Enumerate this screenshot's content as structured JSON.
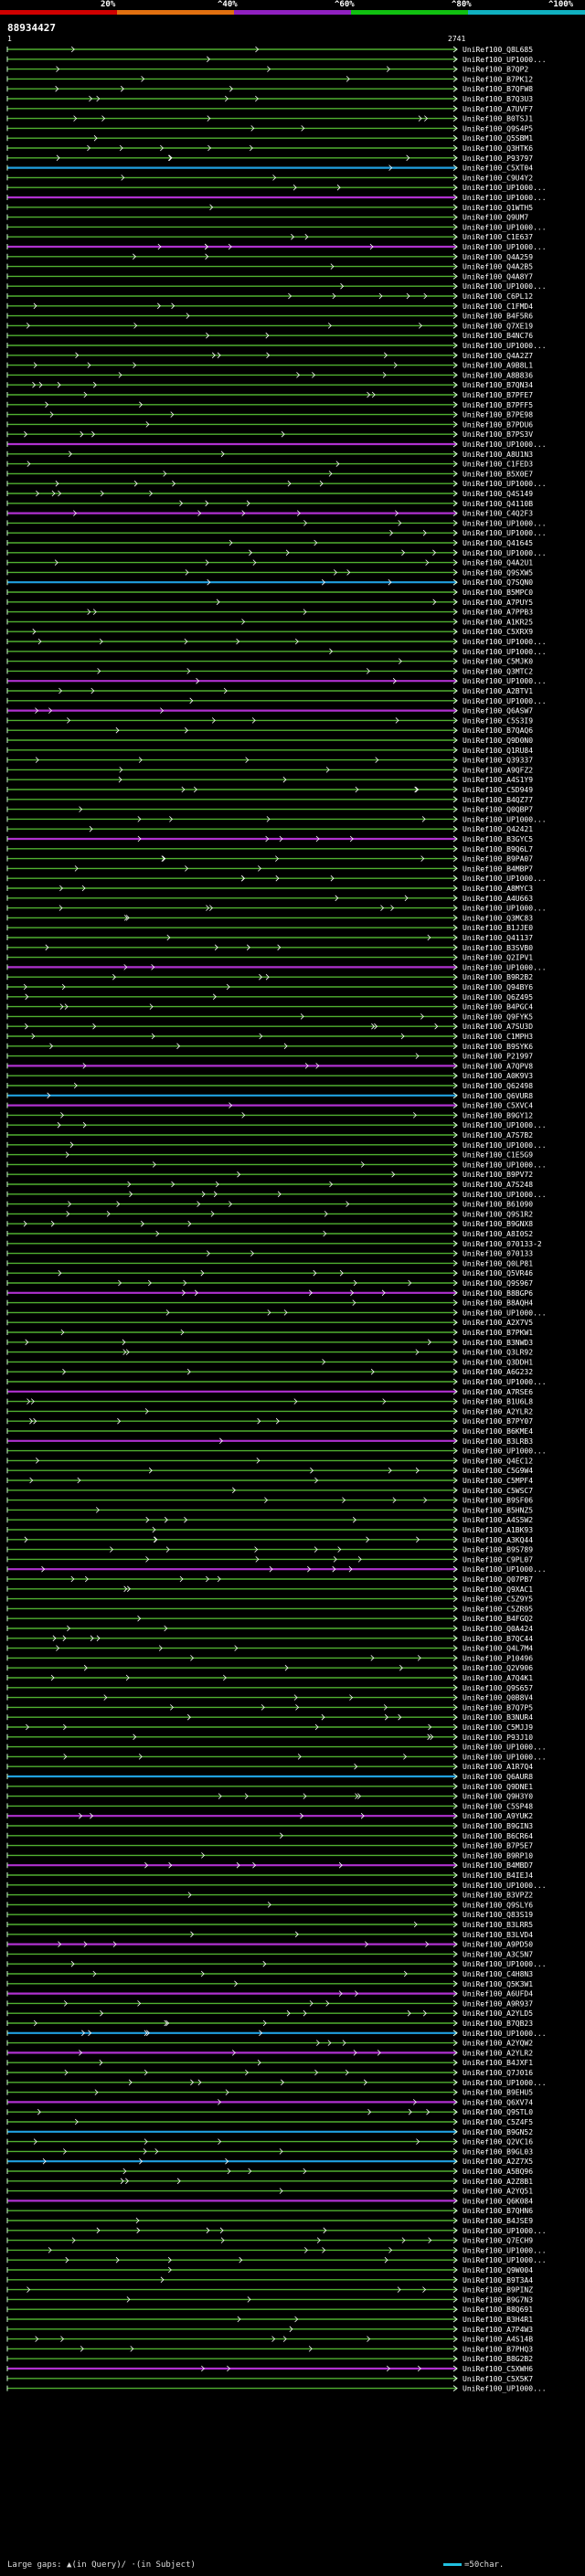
{
  "query": {
    "id": "88934427",
    "length_start": "1",
    "length_end": "2741"
  },
  "legend": {
    "ticks": [
      "20%",
      "^40%",
      "^60%",
      "^80%",
      "^100%"
    ],
    "colors": [
      "#d00000",
      "#e07010",
      "#9020c0",
      "#10c010",
      "#10b0c0"
    ]
  },
  "footer": {
    "note": "Large gaps: ▲(in Query)/ ·(in Subject)",
    "scale_label": "=50char."
  },
  "hits": [
    {
      "label": "UniRef100_Q8L685",
      "color": "#50b030"
    },
    {
      "label": "UniRef100_UP1000...",
      "color": "#50b030"
    },
    {
      "label": "UniRef100_B7QP2",
      "color": "#50b030"
    },
    {
      "label": "UniRef100_B7PK12",
      "color": "#50b030"
    },
    {
      "label": "UniRef100_B7QFW8",
      "color": "#50b030"
    },
    {
      "label": "UniRef100_B7Q3U3",
      "color": "#50b030"
    },
    {
      "label": "UniRef100_A7UVF7",
      "color": "#50b030"
    },
    {
      "label": "UniRef100_B0TSJ1",
      "color": "#50b030"
    },
    {
      "label": "UniRef100_Q9S4P5",
      "color": "#50b030"
    },
    {
      "label": "UniRef100_Q5SBM1",
      "color": "#50b030"
    },
    {
      "label": "UniRef100_Q3HTK6",
      "color": "#50b030"
    },
    {
      "label": "UniRef100_P93797",
      "color": "#50b030"
    },
    {
      "label": "UniRef100_C5XT04",
      "color": "#20a0e0"
    },
    {
      "label": "UniRef100_C9U4Y2",
      "color": "#50b030"
    },
    {
      "label": "UniRef100_UP1000...",
      "color": "#50b030"
    },
    {
      "label": "UniRef100_UP1000...",
      "color": "#b030d0"
    },
    {
      "label": "UniRef100_Q1WTH5",
      "color": "#50b030"
    },
    {
      "label": "UniRef100_Q9UM7",
      "color": "#50b030"
    },
    {
      "label": "UniRef100_UP1000...",
      "color": "#50b030"
    },
    {
      "label": "UniRef100_C1E637",
      "color": "#50b030"
    },
    {
      "label": "UniRef100_UP1000...",
      "color": "#b030d0"
    },
    {
      "label": "UniRef100_Q4A259",
      "color": "#50b030"
    },
    {
      "label": "UniRef100_Q4A2B5",
      "color": "#50b030"
    },
    {
      "label": "UniRef100_Q4A8Y7",
      "color": "#50b030"
    },
    {
      "label": "UniRef100_UP1000...",
      "color": "#50b030"
    },
    {
      "label": "UniRef100_C6PL12",
      "color": "#50b030"
    },
    {
      "label": "UniRef100_C1FMD4",
      "color": "#50b030"
    },
    {
      "label": "UniRef100_B4F5R6",
      "color": "#50b030"
    },
    {
      "label": "UniRef100_Q7XE19",
      "color": "#50b030"
    },
    {
      "label": "UniRef100_B4NC76",
      "color": "#50b030"
    },
    {
      "label": "UniRef100_UP1000...",
      "color": "#50b030"
    },
    {
      "label": "UniRef100_Q4A2Z7",
      "color": "#50b030"
    },
    {
      "label": "UniRef100_A9B8L1",
      "color": "#50b030"
    },
    {
      "label": "UniRef100_A8B836",
      "color": "#50b030"
    },
    {
      "label": "UniRef100_B7QN34",
      "color": "#50b030"
    },
    {
      "label": "UniRef100_B7PFE7",
      "color": "#50b030"
    },
    {
      "label": "UniRef100_B7PFF5",
      "color": "#50b030"
    },
    {
      "label": "UniRef100_B7PE98",
      "color": "#50b030"
    },
    {
      "label": "UniRef100_B7PDU6",
      "color": "#50b030"
    },
    {
      "label": "UniRef100_B7PS3V",
      "color": "#50b030"
    },
    {
      "label": "UniRef100_UP1000...",
      "color": "#b030d0"
    },
    {
      "label": "UniRef100_A8U1N3",
      "color": "#50b030"
    },
    {
      "label": "UniRef100_C1FED3",
      "color": "#50b030"
    },
    {
      "label": "UniRef100_B5X0E7",
      "color": "#50b030"
    },
    {
      "label": "UniRef100_UP1000...",
      "color": "#50b030"
    },
    {
      "label": "UniRef100_Q4S149",
      "color": "#50b030"
    },
    {
      "label": "UniRef100_Q4110B",
      "color": "#50b030"
    },
    {
      "label": "UniRef100_C4Q2F3",
      "color": "#b030d0"
    },
    {
      "label": "UniRef100_UP1000...",
      "color": "#50b030"
    },
    {
      "label": "UniRef100_UP1000...",
      "color": "#50b030"
    },
    {
      "label": "UniRef100_Q41645",
      "color": "#50b030"
    },
    {
      "label": "UniRef100_UP1000...",
      "color": "#50b030"
    },
    {
      "label": "UniRef100_Q4A2U1",
      "color": "#50b030"
    },
    {
      "label": "UniRef100_Q9SXW5",
      "color": "#50b030"
    },
    {
      "label": "UniRef100_Q7SQN0",
      "color": "#20a0e0"
    },
    {
      "label": "UniRef100_B5MPC0",
      "color": "#50b030"
    },
    {
      "label": "UniRef100_A7PUY5",
      "color": "#50b030"
    },
    {
      "label": "UniRef100_A7PPB3",
      "color": "#50b030"
    },
    {
      "label": "UniRef100_A1KR25",
      "color": "#50b030"
    },
    {
      "label": "UniRef100_C5XRX9",
      "color": "#50b030"
    },
    {
      "label": "UniRef100_UP1000...",
      "color": "#50b030"
    },
    {
      "label": "UniRef100_UP1000...",
      "color": "#50b030"
    },
    {
      "label": "UniRef100_C5MJK0",
      "color": "#50b030"
    },
    {
      "label": "UniRef100_Q3MTC2",
      "color": "#50b030"
    },
    {
      "label": "UniRef100_UP1000...",
      "color": "#b030d0"
    },
    {
      "label": "UniRef100_A2BTV1",
      "color": "#50b030"
    },
    {
      "label": "UniRef100_UP1000...",
      "color": "#50b030"
    },
    {
      "label": "UniRef100_Q6ASW7",
      "color": "#b030d0"
    },
    {
      "label": "UniRef100_C5S3I9",
      "color": "#50b030"
    },
    {
      "label": "UniRef100_B7QAQ6",
      "color": "#50b030"
    },
    {
      "label": "UniRef100_Q9D0N0",
      "color": "#50b030"
    },
    {
      "label": "UniRef100_Q1RU84",
      "color": "#50b030"
    },
    {
      "label": "UniRef100_Q39337",
      "color": "#50b030"
    },
    {
      "label": "UniRef100_A9QFZ2",
      "color": "#50b030"
    },
    {
      "label": "UniRef100_A4S1Y9",
      "color": "#50b030"
    },
    {
      "label": "UniRef100_C5D949",
      "color": "#50b030"
    },
    {
      "label": "UniRef100_B4QZ77",
      "color": "#50b030"
    },
    {
      "label": "UniRef100_Q0QBP7",
      "color": "#50b030"
    },
    {
      "label": "UniRef100_UP1000...",
      "color": "#50b030"
    },
    {
      "label": "UniRef100_Q42421",
      "color": "#50b030"
    },
    {
      "label": "UniRef100_B3GYC5",
      "color": "#b030d0"
    },
    {
      "label": "UniRef100_B9Q6L7",
      "color": "#50b030"
    },
    {
      "label": "UniRef100_B9PA07",
      "color": "#50b030"
    },
    {
      "label": "UniRef100_B4MBP7",
      "color": "#50b030"
    },
    {
      "label": "UniRef100_UP1000...",
      "color": "#50b030"
    },
    {
      "label": "UniRef100_A8MYC3",
      "color": "#50b030"
    },
    {
      "label": "UniRef100_A4U663",
      "color": "#50b030"
    },
    {
      "label": "UniRef100_UP1000...",
      "color": "#50b030"
    },
    {
      "label": "UniRef100_Q3MC83",
      "color": "#50b030"
    },
    {
      "label": "UniRef100_B1JJE0",
      "color": "#50b030"
    },
    {
      "label": "UniRef100_Q41137",
      "color": "#50b030"
    },
    {
      "label": "UniRef100_B3SVB0",
      "color": "#50b030"
    },
    {
      "label": "UniRef100_Q2IPV1",
      "color": "#50b030"
    },
    {
      "label": "UniRef100_UP1000...",
      "color": "#b030d0"
    },
    {
      "label": "UniRef100_B9R2B2",
      "color": "#50b030"
    },
    {
      "label": "UniRef100_Q94BY6",
      "color": "#50b030"
    },
    {
      "label": "UniRef100_Q6Z495",
      "color": "#50b030"
    },
    {
      "label": "UniRef100_B4PGC4",
      "color": "#50b030"
    },
    {
      "label": "UniRef100_Q9FYK5",
      "color": "#50b030"
    },
    {
      "label": "UniRef100_A7SU3D",
      "color": "#50b030"
    },
    {
      "label": "UniRef100_C1MPH3",
      "color": "#50b030"
    },
    {
      "label": "UniRef100_B9SYK6",
      "color": "#50b030"
    },
    {
      "label": "UniRef100_P21997",
      "color": "#50b030"
    },
    {
      "label": "UniRef100_A7QPV8",
      "color": "#b030d0"
    },
    {
      "label": "UniRef100_A0K9V3",
      "color": "#50b030"
    },
    {
      "label": "UniRef100_Q62498",
      "color": "#50b030"
    },
    {
      "label": "UniRef100_Q6VUR8",
      "color": "#20a0e0"
    },
    {
      "label": "UniRef100_C5XVC4",
      "color": "#b030d0"
    },
    {
      "label": "UniRef100_B9GY12",
      "color": "#50b030"
    },
    {
      "label": "UniRef100_UP1000...",
      "color": "#50b030"
    },
    {
      "label": "UniRef100_A7S7B2",
      "color": "#50b030"
    },
    {
      "label": "UniRef100_UP1000...",
      "color": "#50b030"
    },
    {
      "label": "UniRef100_C1E5G9",
      "color": "#50b030"
    },
    {
      "label": "UniRef100_UP1000...",
      "color": "#50b030"
    },
    {
      "label": "UniRef100_B9PV72",
      "color": "#50b030"
    },
    {
      "label": "UniRef100_A7S248",
      "color": "#50b030"
    },
    {
      "label": "UniRef100_UP1000...",
      "color": "#50b030"
    },
    {
      "label": "UniRef100_B61090",
      "color": "#50b030"
    },
    {
      "label": "UniRef100_Q9S1R2",
      "color": "#50b030"
    },
    {
      "label": "UniRef100_B9GNX8",
      "color": "#50b030"
    },
    {
      "label": "UniRef100_A8I0S2",
      "color": "#50b030"
    },
    {
      "label": "UniRef100_070133-2",
      "color": "#50b030"
    },
    {
      "label": "UniRef100_070133",
      "color": "#50b030"
    },
    {
      "label": "UniRef100_Q0LP81",
      "color": "#50b030"
    },
    {
      "label": "UniRef100_Q5VR46",
      "color": "#50b030"
    },
    {
      "label": "UniRef100_Q9S967",
      "color": "#50b030"
    },
    {
      "label": "UniRef100_B8BGP6",
      "color": "#b030d0"
    },
    {
      "label": "UniRef100_B8AQH4",
      "color": "#50b030"
    },
    {
      "label": "UniRef100_UP1000...",
      "color": "#50b030"
    },
    {
      "label": "UniRef100_A2X7V5",
      "color": "#50b030"
    },
    {
      "label": "UniRef100_B7PKW1",
      "color": "#50b030"
    },
    {
      "label": "UniRef100_B3NWD3",
      "color": "#50b030"
    },
    {
      "label": "UniRef100_Q3LR92",
      "color": "#50b030"
    },
    {
      "label": "UniRef100_Q3DDH1",
      "color": "#50b030"
    },
    {
      "label": "UniRef100_A6G232",
      "color": "#50b030"
    },
    {
      "label": "UniRef100_UP1000...",
      "color": "#50b030"
    },
    {
      "label": "UniRef100_A7RSE6",
      "color": "#b030d0"
    },
    {
      "label": "UniRef100_B1U6L8",
      "color": "#50b030"
    },
    {
      "label": "UniRef100_A2YLR2",
      "color": "#50b030"
    },
    {
      "label": "UniRef100_B7PY07",
      "color": "#50b030"
    },
    {
      "label": "UniRef100_B6KME4",
      "color": "#50b030"
    },
    {
      "label": "UniRef100_B3LRB3",
      "color": "#b030d0"
    },
    {
      "label": "UniRef100_UP1000...",
      "color": "#50b030"
    },
    {
      "label": "UniRef100_Q4EC12",
      "color": "#50b030"
    },
    {
      "label": "UniRef100_C5G9W4",
      "color": "#50b030"
    },
    {
      "label": "UniRef100_C5MPF4",
      "color": "#50b030"
    },
    {
      "label": "UniRef100_C5WSC7",
      "color": "#50b030"
    },
    {
      "label": "UniRef100_B9SF06",
      "color": "#50b030"
    },
    {
      "label": "UniRef100_B5HNZ5",
      "color": "#50b030"
    },
    {
      "label": "UniRef100_A4S5W2",
      "color": "#50b030"
    },
    {
      "label": "UniRef100_A1BK93",
      "color": "#50b030"
    },
    {
      "label": "UniRef100_A3KQ44",
      "color": "#50b030"
    },
    {
      "label": "UniRef100_B9S789",
      "color": "#50b030"
    },
    {
      "label": "UniRef100_C9PL07",
      "color": "#50b030"
    },
    {
      "label": "UniRef100_UP1000...",
      "color": "#b030d0"
    },
    {
      "label": "UniRef100_Q07PB7",
      "color": "#50b030"
    },
    {
      "label": "UniRef100_Q9XAC1",
      "color": "#50b030"
    },
    {
      "label": "UniRef100_C5Z9Y5",
      "color": "#50b030"
    },
    {
      "label": "UniRef100_C5ZR95",
      "color": "#50b030"
    },
    {
      "label": "UniRef100_B4FGQ2",
      "color": "#50b030"
    },
    {
      "label": "UniRef100_Q0A424",
      "color": "#50b030"
    },
    {
      "label": "UniRef100_B7QC44",
      "color": "#50b030"
    },
    {
      "label": "UniRef100_Q4L7M4",
      "color": "#50b030"
    },
    {
      "label": "UniRef100_P10496",
      "color": "#50b030"
    },
    {
      "label": "UniRef100_Q2V906",
      "color": "#50b030"
    },
    {
      "label": "UniRef100_A7Q4K1",
      "color": "#50b030"
    },
    {
      "label": "UniRef100_Q9S657",
      "color": "#50b030"
    },
    {
      "label": "UniRef100_Q0B8V4",
      "color": "#50b030"
    },
    {
      "label": "UniRef100_B7Q7P5",
      "color": "#50b030"
    },
    {
      "label": "UniRef100_B3NUR4",
      "color": "#50b030"
    },
    {
      "label": "UniRef100_C5MJJ9",
      "color": "#50b030"
    },
    {
      "label": "UniRef100_P93J10",
      "color": "#50b030"
    },
    {
      "label": "UniRef100_UP1000...",
      "color": "#50b030"
    },
    {
      "label": "UniRef100_UP1000...",
      "color": "#50b030"
    },
    {
      "label": "UniRef100_A1R7Q4",
      "color": "#50b030"
    },
    {
      "label": "UniRef100_Q6AUR8",
      "color": "#20a0e0"
    },
    {
      "label": "UniRef100_Q9DNE1",
      "color": "#50b030"
    },
    {
      "label": "UniRef100_Q9H3Y0",
      "color": "#50b030"
    },
    {
      "label": "UniRef100_C5SP48",
      "color": "#50b030"
    },
    {
      "label": "UniRef100_A9YUK2",
      "color": "#b030d0"
    },
    {
      "label": "UniRef100_B9GIN3",
      "color": "#50b030"
    },
    {
      "label": "UniRef100_B6CR64",
      "color": "#50b030"
    },
    {
      "label": "UniRef100_B7P5E7",
      "color": "#50b030"
    },
    {
      "label": "UniRef100_B9RP10",
      "color": "#50b030"
    },
    {
      "label": "UniRef100_B4MBD7",
      "color": "#b030d0"
    },
    {
      "label": "UniRef100_B4IEJ4",
      "color": "#50b030"
    },
    {
      "label": "UniRef100_UP1000...",
      "color": "#50b030"
    },
    {
      "label": "UniRef100_B3VPZ2",
      "color": "#50b030"
    },
    {
      "label": "UniRef100_Q9SLY6",
      "color": "#50b030"
    },
    {
      "label": "UniRef100_Q83S19",
      "color": "#50b030"
    },
    {
      "label": "UniRef100_B3LRR5",
      "color": "#50b030"
    },
    {
      "label": "UniRef100_B3LVD4",
      "color": "#50b030"
    },
    {
      "label": "UniRef100_A9PD50",
      "color": "#b030d0"
    },
    {
      "label": "UniRef100_A3C5N7",
      "color": "#50b030"
    },
    {
      "label": "UniRef100_UP1000...",
      "color": "#50b030"
    },
    {
      "label": "UniRef100_C4H8N3",
      "color": "#50b030"
    },
    {
      "label": "UniRef100_Q5K3W1",
      "color": "#50b030"
    },
    {
      "label": "UniRef100_A6UFD4",
      "color": "#b030d0"
    },
    {
      "label": "UniRef100_A9R937",
      "color": "#50b030"
    },
    {
      "label": "UniRef100_A2YLD5",
      "color": "#50b030"
    },
    {
      "label": "UniRef100_B7QB23",
      "color": "#50b030"
    },
    {
      "label": "UniRef100_UP1000...",
      "color": "#20a0e0"
    },
    {
      "label": "UniRef100_A2YQW2",
      "color": "#50b030"
    },
    {
      "label": "UniRef100_A2YLR2",
      "color": "#b030d0"
    },
    {
      "label": "UniRef100_B4JXF1",
      "color": "#50b030"
    },
    {
      "label": "UniRef100_Q7J016",
      "color": "#50b030"
    },
    {
      "label": "UniRef100_UP1000...",
      "color": "#50b030"
    },
    {
      "label": "UniRef100_B9EHU5",
      "color": "#50b030"
    },
    {
      "label": "UniRef100_Q6XV74",
      "color": "#b030d0"
    },
    {
      "label": "UniRef100_Q9STL0",
      "color": "#50b030"
    },
    {
      "label": "UniRef100_C5Z4F5",
      "color": "#50b030"
    },
    {
      "label": "UniRef100_B9GN52",
      "color": "#20a0e0"
    },
    {
      "label": "UniRef100_Q2VC16",
      "color": "#50b030"
    },
    {
      "label": "UniRef100_B9GL03",
      "color": "#50b030"
    },
    {
      "label": "UniRef100_A2Z7X5",
      "color": "#20a0e0"
    },
    {
      "label": "UniRef100_A5BQ96",
      "color": "#50b030"
    },
    {
      "label": "UniRef100_A2Z8B1",
      "color": "#50b030"
    },
    {
      "label": "UniRef100_A2YQ51",
      "color": "#50b030"
    },
    {
      "label": "UniRef100_Q6K084",
      "color": "#b030d0"
    },
    {
      "label": "UniRef100_B7QHN6",
      "color": "#50b030"
    },
    {
      "label": "UniRef100_B4JSE9",
      "color": "#50b030"
    },
    {
      "label": "UniRef100_UP1000...",
      "color": "#50b030"
    },
    {
      "label": "UniRef100_Q7ECH9",
      "color": "#50b030"
    },
    {
      "label": "UniRef100_UP1000...",
      "color": "#50b030"
    },
    {
      "label": "UniRef100_UP1000...",
      "color": "#50b030"
    },
    {
      "label": "UniRef100_Q9W004",
      "color": "#50b030"
    },
    {
      "label": "UniRef100_B9T3A4",
      "color": "#50b030"
    },
    {
      "label": "UniRef100_B9PINZ",
      "color": "#50b030"
    },
    {
      "label": "UniRef100_B9G7N3",
      "color": "#50b030"
    },
    {
      "label": "UniRef100_B8Q691",
      "color": "#50b030"
    },
    {
      "label": "UniRef100_B3H4R1",
      "color": "#50b030"
    },
    {
      "label": "UniRef100_A7P4W3",
      "color": "#50b030"
    },
    {
      "label": "UniRef100_A4S14B",
      "color": "#50b030"
    },
    {
      "label": "UniRef100_B7PHQ3",
      "color": "#50b030"
    },
    {
      "label": "UniRef100_B8G2B2",
      "color": "#50b030"
    },
    {
      "label": "UniRef100_C5XWH6",
      "color": "#b030d0"
    },
    {
      "label": "UniRef100_C5X5K7",
      "color": "#50b030"
    },
    {
      "label": "UniRef100_UP1000...",
      "color": "#50b030"
    }
  ]
}
